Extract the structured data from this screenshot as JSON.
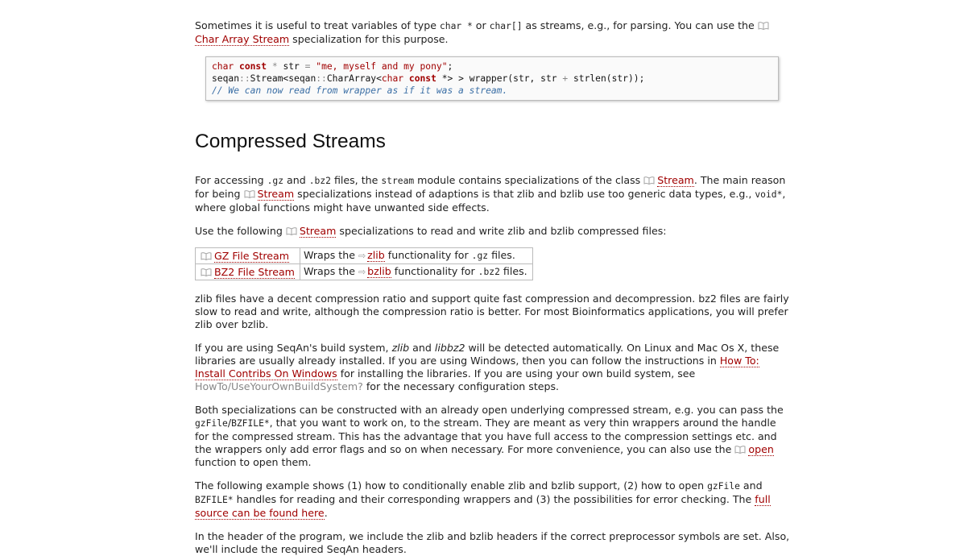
{
  "intro": {
    "t1": "Sometimes it is useful to treat variables of type ",
    "code1": "char *",
    "t2": " or ",
    "code2": "char[]",
    "t3": " as streams, e.g., for parsing. You can use the ",
    "link": "Char Array Stream",
    "t4": " specialization for this purpose."
  },
  "code_block": {
    "l1_kw": "char",
    "l1_const": "const",
    "l1_op1": " * ",
    "l1_var": "str",
    "l1_eq": " = ",
    "l1_str": "\"me, myself and my pony\"",
    "l1_end": ";",
    "l2_a": "seqan",
    "l2_b": "::",
    "l2_c": "Stream<seqan",
    "l2_d": "::",
    "l2_e": "CharArray<",
    "l2_kw": "char",
    "l2_const": "const",
    "l2_f": " *> > wrapper(str, str ",
    "l2_plus": "+",
    "l2_g": " strlen(str));",
    "l3_comment": "// We can now read from wrapper as if it was a stream."
  },
  "heading": "Compressed Streams",
  "para1": {
    "t1": "For accessing ",
    "c1": ".gz",
    "t2": " and ",
    "c2": ".bz2",
    "t3": " files, the ",
    "c3": "stream",
    "t4": " module contains specializations of the class ",
    "link1": "Stream",
    "t5": ". The main reason for being ",
    "link2": "Stream",
    "t6": " specializations instead of adaptions is that zlib and bzlib use too generic data types, e.g., ",
    "c4": "void*",
    "t7": ", where global functions might have unwanted side effects."
  },
  "para2": {
    "t1": "Use the following ",
    "link": "Stream",
    "t2": " specializations to read and write zlib and bzlib compressed files:"
  },
  "table": {
    "rows": [
      {
        "name": "GZ File Stream",
        "t1": "Wraps the ",
        "lib": "zlib",
        "t2": " functionality for ",
        "ext": ".gz",
        "t3": " files."
      },
      {
        "name": "BZ2 File Stream",
        "t1": "Wraps the ",
        "lib": "bzlib",
        "t2": " functionality for ",
        "ext": ".bz2",
        "t3": " files."
      }
    ]
  },
  "para3": "zlib files have a decent compression ratio and support quite fast compression and decompression. bz2 files are fairly slow to read and write, although the compression ratio is better. For most Bioinformatics applications, you will prefer zlib over bzlib.",
  "para4": {
    "t1": "If you are using SeqAn's build system, ",
    "i1": "zlib",
    "t2": " and ",
    "i2": "libbz2",
    "t3": " will be detected automatically. On Linux and Mac Os X, these libraries are usually already installed. If you are using Windows, then you can follow the instructions in ",
    "link1": "How To: Install Contribs On Windows",
    "t4": " for installing the libraries. If you are using your own build system, see ",
    "link2": "HowTo/UseYourOwnBuildSystem?",
    "t5": " for the necessary configuration steps."
  },
  "para5": {
    "t1": "Both specializations can be constructed with an already open underlying compressed stream, e.g. you can pass the ",
    "c1": "gzFile",
    "t2": "/",
    "c2": "BZFILE*",
    "t3": ", that you want to work on, to the stream. They are meant as very thin wrappers around the handle for the compressed stream. This has the advantage that you have full access to the compression settings etc. and the wrappers only add error flags and so on when necessary. For more convenience, you can also use the ",
    "link": "open",
    "t4": " function to open them."
  },
  "para6": {
    "t1": "The following example shows (1) how to conditionally enable zlib and bzlib support, (2) how to open ",
    "c1": "gzFile",
    "t2": " and ",
    "c2": "BZFILE*",
    "t3": " handles for reading and their corresponding wrappers and (3) the possibilities for error checking. The ",
    "link": "full source can be found here",
    "t4": "."
  },
  "para7": "In the header of the program, we include the zlib and bzlib headers if the correct preprocessor symbols are set. Also, we'll include the required SeqAn headers."
}
